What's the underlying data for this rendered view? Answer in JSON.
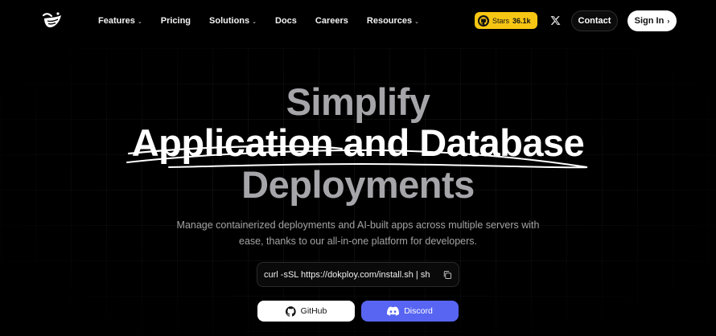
{
  "nav": {
    "logo_icon": "dokploy-logo-icon",
    "links": [
      {
        "label": "Features",
        "has_dropdown": true
      },
      {
        "label": "Pricing",
        "has_dropdown": false
      },
      {
        "label": "Solutions",
        "has_dropdown": true
      },
      {
        "label": "Docs",
        "has_dropdown": false
      },
      {
        "label": "Careers",
        "has_dropdown": false
      },
      {
        "label": "Resources",
        "has_dropdown": true
      }
    ],
    "stars_label": "Stars",
    "stars_count": "36.1k",
    "contact_label": "Contact",
    "signin_label": "Sign In",
    "signin_icon": "chevron-right-icon"
  },
  "hero": {
    "line1": "Simplify",
    "line2": "Application and Database",
    "line3": "Deployments",
    "subtitle_line1": "Manage containerized deployments and AI-built apps across multiple servers with",
    "subtitle_line2": "ease, thanks to our all-in-one platform for developers."
  },
  "install": {
    "command": "curl -sSL https://dokploy.com/install.sh | sh",
    "copy_icon": "copy-icon"
  },
  "buttons": {
    "github_label": "GitHub",
    "discord_label": "Discord"
  },
  "colors": {
    "background": "#000000",
    "stars_badge": "#f7c613",
    "discord": "#5865f2",
    "muted_heading": "#a6a6aa"
  }
}
